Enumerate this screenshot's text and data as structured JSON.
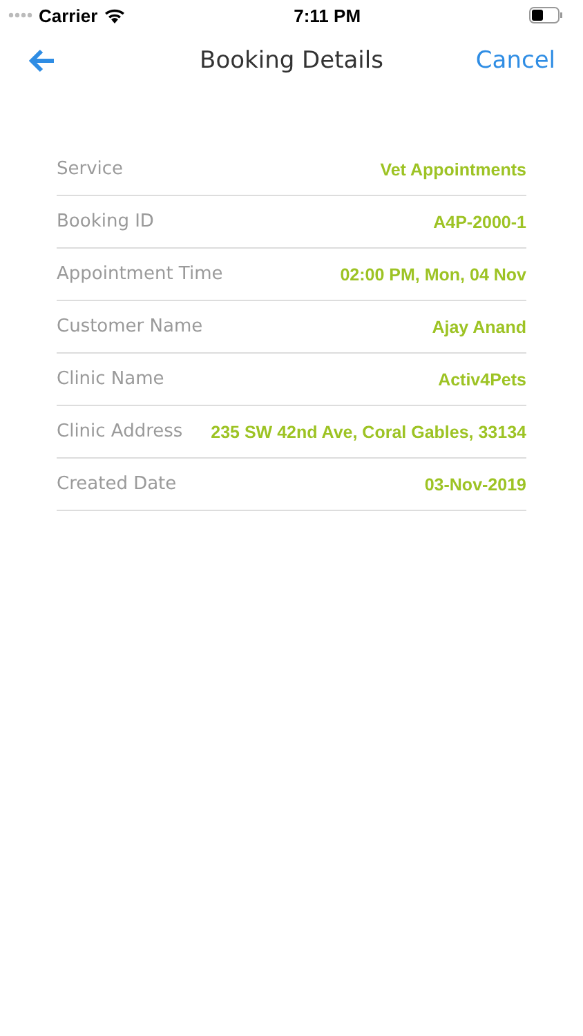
{
  "status_bar": {
    "carrier": "Carrier",
    "time": "7:11 PM"
  },
  "nav": {
    "title": "Booking Details",
    "cancel": "Cancel"
  },
  "details": [
    {
      "label": "Service",
      "value": "Vet Appointments"
    },
    {
      "label": "Booking ID",
      "value": "A4P-2000-1"
    },
    {
      "label": "Appointment Time",
      "value": "02:00 PM, Mon, 04 Nov"
    },
    {
      "label": "Customer Name",
      "value": "Ajay Anand"
    },
    {
      "label": "Clinic Name",
      "value": "Activ4Pets"
    },
    {
      "label": "Clinic Address",
      "value": "235 SW 42nd Ave, Coral Gables, 33134"
    },
    {
      "label": "Created Date",
      "value": "03-Nov-2019"
    }
  ]
}
